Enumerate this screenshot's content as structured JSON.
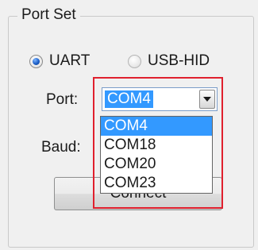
{
  "group": {
    "title": "Port Set"
  },
  "mode": {
    "options": [
      {
        "label": "UART",
        "checked": true
      },
      {
        "label": "USB-HID",
        "checked": false
      }
    ]
  },
  "port": {
    "label": "Port:",
    "selected": "COM4",
    "options": [
      "COM4",
      "COM18",
      "COM20",
      "COM23"
    ]
  },
  "baud": {
    "label": "Baud:"
  },
  "connect": {
    "label": "Connect"
  },
  "colors": {
    "selection": "#3399ff",
    "annotation_frame": "#e0202e"
  }
}
